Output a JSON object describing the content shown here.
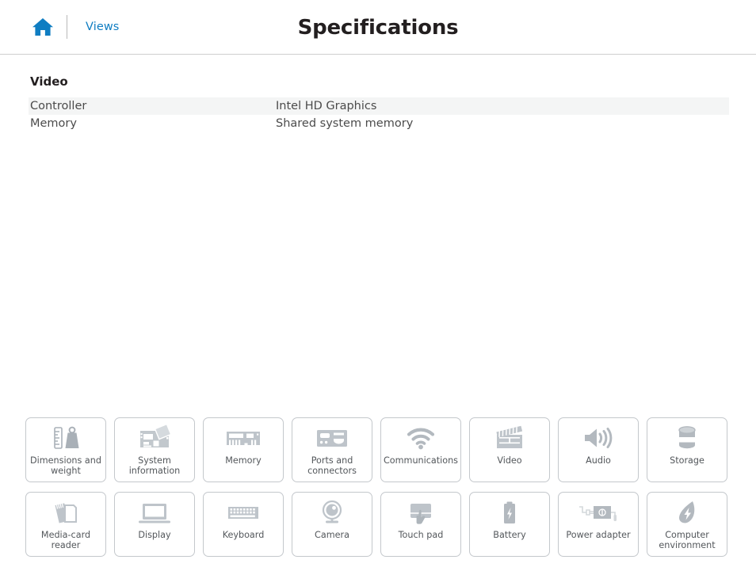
{
  "header": {
    "home_icon": "home-icon",
    "views_label": "Views",
    "title": "Specifications"
  },
  "main": {
    "section_title": "Video",
    "rows": [
      {
        "key": "Controller",
        "value": "Intel HD Graphics"
      },
      {
        "key": "Memory",
        "value": "Shared system memory"
      }
    ]
  },
  "tiles": [
    {
      "label": "Dimensions and\nweight",
      "icon": "ruler-weight-icon"
    },
    {
      "label": "System\ninformation",
      "icon": "motherboard-icon"
    },
    {
      "label": "Memory",
      "icon": "ram-module-icon"
    },
    {
      "label": "Ports and\nconnectors",
      "icon": "ports-icon"
    },
    {
      "label": "Communications",
      "icon": "wifi-icon"
    },
    {
      "label": "Video",
      "icon": "clapperboard-icon"
    },
    {
      "label": "Audio",
      "icon": "speaker-icon"
    },
    {
      "label": "Storage",
      "icon": "disk-cylinder-icon"
    },
    {
      "label": "Media-card\nreader",
      "icon": "memory-card-icon"
    },
    {
      "label": "Display",
      "icon": "laptop-screen-icon"
    },
    {
      "label": "Keyboard",
      "icon": "keyboard-icon"
    },
    {
      "label": "Camera",
      "icon": "webcam-icon"
    },
    {
      "label": "Touch pad",
      "icon": "touchpad-icon"
    },
    {
      "label": "Battery",
      "icon": "battery-icon"
    },
    {
      "label": "Power adapter",
      "icon": "power-adapter-icon"
    },
    {
      "label": "Computer\nenvironment",
      "icon": "leaf-bolt-icon"
    }
  ],
  "colors": {
    "accent": "#0f7dc2",
    "icon_gray": "#a9b0b7",
    "row_alt": "#f4f5f5",
    "border": "#c4c8cc",
    "text": "#53575b"
  }
}
